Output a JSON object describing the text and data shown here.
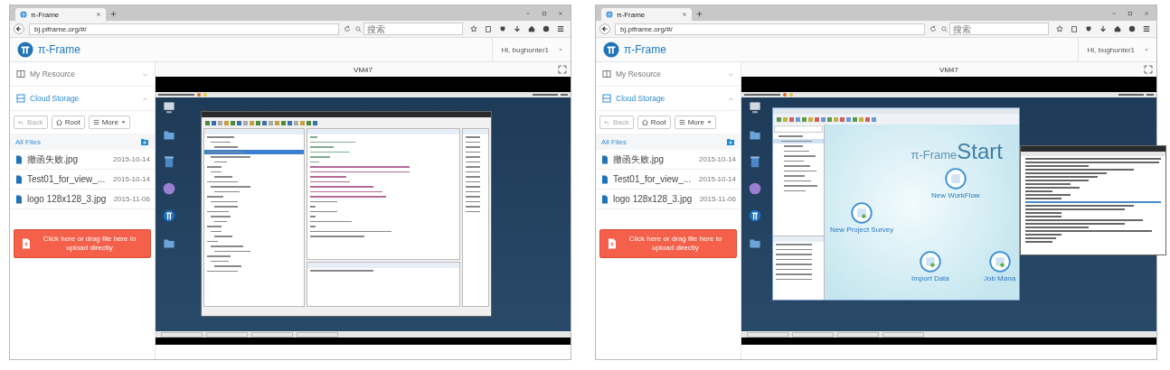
{
  "browsers": [
    {
      "tab_title": "π-Frame",
      "url": "bj.piframe.org/#/",
      "search_placeholder": "搜索",
      "brand": "π-Frame",
      "greeting": "Hi, bughunter1",
      "sidebar": {
        "sections": [
          {
            "label": "My Resource",
            "expanded": false,
            "selected": false
          },
          {
            "label": "Cloud Storage",
            "expanded": true,
            "selected": true
          }
        ],
        "toolbar": [
          {
            "label": "Back",
            "disabled": true,
            "kind": "back"
          },
          {
            "label": "Root",
            "disabled": false,
            "kind": "home"
          },
          {
            "label": "More",
            "disabled": false,
            "kind": "menu"
          }
        ],
        "breadcrumb": "All Files",
        "files": [
          {
            "name": "撤函失败.jpg",
            "date": "2015-10-14"
          },
          {
            "name": "Test01_for_view_...",
            "date": "2015-10-14"
          },
          {
            "name": "logo 128x128_3.jpg",
            "date": "2015-11-06"
          }
        ],
        "upload": "Click here or drag file here to upload directly"
      },
      "vm": {
        "title": "VM47",
        "windows": [
          {
            "kind": "eclipse"
          }
        ]
      }
    },
    {
      "tab_title": "π-Frame",
      "url": "bj.piframe.org/#/",
      "search_placeholder": "搜索",
      "brand": "π-Frame",
      "greeting": "Hi, bughunter1",
      "sidebar": {
        "sections": [
          {
            "label": "My Resource",
            "expanded": false,
            "selected": false
          },
          {
            "label": "Cloud Storage",
            "expanded": true,
            "selected": true
          }
        ],
        "toolbar": [
          {
            "label": "Back",
            "disabled": true,
            "kind": "back"
          },
          {
            "label": "Root",
            "disabled": false,
            "kind": "home"
          },
          {
            "label": "More",
            "disabled": false,
            "kind": "menu"
          }
        ],
        "breadcrumb": "All Files",
        "files": [
          {
            "name": "撤函失败.jpg",
            "date": "2015-10-14"
          },
          {
            "name": "Test01_for_view_...",
            "date": "2015-10-14"
          },
          {
            "name": "logo 128x128_3.jpg",
            "date": "2015-11-06"
          }
        ],
        "upload": "Click here or drag file here to upload directly"
      },
      "vm": {
        "title": "VM47",
        "windows": [
          {
            "kind": "piframe",
            "brand_main": "π-Frame",
            "brand_start": "Start",
            "actions": [
              {
                "label": "New WorkFlow",
                "kind": "workflow"
              },
              {
                "label": "New Project Survey",
                "kind": "project"
              },
              {
                "label": "Import Data",
                "kind": "import"
              },
              {
                "label": "Job Mana",
                "kind": "job"
              }
            ]
          },
          {
            "kind": "terminal"
          }
        ]
      }
    }
  ]
}
